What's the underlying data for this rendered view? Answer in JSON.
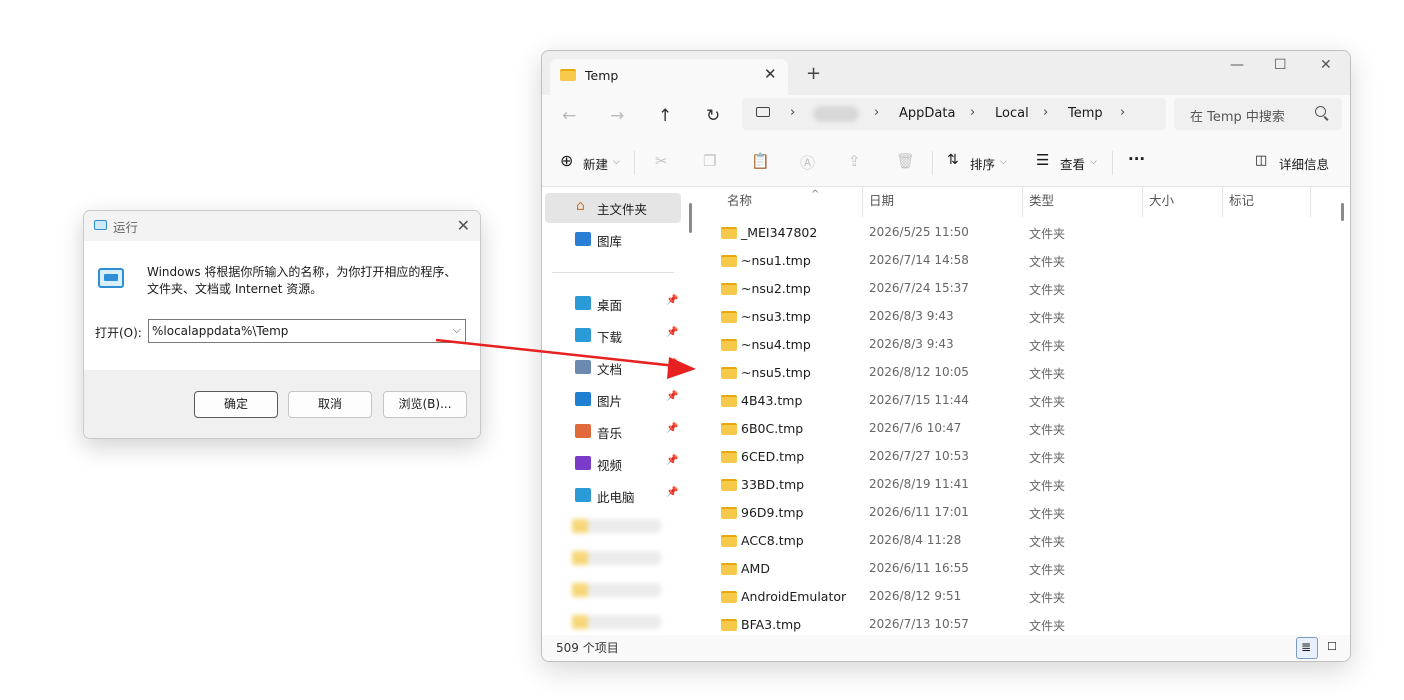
{
  "run": {
    "title": "运行",
    "close": "✕",
    "description": "Windows 将根据你所输入的名称，为你打开相应的程序、文件夹、文档或 Internet 资源。",
    "open_label": "打开(O):",
    "open_value": "%localappdata%\\Temp",
    "ok": "确定",
    "cancel": "取消",
    "browse": "浏览(B)..."
  },
  "explorer": {
    "tab_title": "Temp",
    "tab_close": "✕",
    "new_tab": "+",
    "window_controls": {
      "minimize": "—",
      "maximize": "☐",
      "close": "✕"
    },
    "nav": {
      "back": "←",
      "forward": "→",
      "up": "↑",
      "refresh": "↻"
    },
    "breadcrumb": [
      "AppData",
      "Local",
      "Temp"
    ],
    "breadcrumb_sep": "›",
    "search_placeholder": "在 Temp 中搜索",
    "toolbar": {
      "new": "新建",
      "sort": "排序",
      "view": "查看",
      "more": "···",
      "details": "详细信息"
    },
    "sidebar": {
      "home": "主文件夹",
      "gallery": "图库",
      "pinned": [
        {
          "label": "桌面",
          "color": "#2a9bd6"
        },
        {
          "label": "下载",
          "color": "#2a9bd6"
        },
        {
          "label": "文档",
          "color": "#6c8ab0"
        },
        {
          "label": "图片",
          "color": "#1f7fd0"
        },
        {
          "label": "音乐",
          "color": "#e06a3b"
        },
        {
          "label": "视频",
          "color": "#7a3cc8"
        },
        {
          "label": "此电脑",
          "color": "#2a9bd6"
        }
      ]
    },
    "columns": [
      "名称",
      "日期",
      "类型",
      "大小",
      "标记"
    ],
    "rows": [
      {
        "name": "_MEI347802",
        "date": "2026/5/25 11:50",
        "type": "文件夹"
      },
      {
        "name": "~nsu1.tmp",
        "date": "2026/7/14 14:58",
        "type": "文件夹"
      },
      {
        "name": "~nsu2.tmp",
        "date": "2026/7/24 15:37",
        "type": "文件夹"
      },
      {
        "name": "~nsu3.tmp",
        "date": "2026/8/3 9:43",
        "type": "文件夹"
      },
      {
        "name": "~nsu4.tmp",
        "date": "2026/8/3 9:43",
        "type": "文件夹"
      },
      {
        "name": "~nsu5.tmp",
        "date": "2026/8/12 10:05",
        "type": "文件夹"
      },
      {
        "name": "4B43.tmp",
        "date": "2026/7/15 11:44",
        "type": "文件夹"
      },
      {
        "name": "6B0C.tmp",
        "date": "2026/7/6 10:47",
        "type": "文件夹"
      },
      {
        "name": "6CED.tmp",
        "date": "2026/7/27 10:53",
        "type": "文件夹"
      },
      {
        "name": "33BD.tmp",
        "date": "2026/8/19 11:41",
        "type": "文件夹"
      },
      {
        "name": "96D9.tmp",
        "date": "2026/6/11 17:01",
        "type": "文件夹"
      },
      {
        "name": "ACC8.tmp",
        "date": "2026/8/4 11:28",
        "type": "文件夹"
      },
      {
        "name": "AMD",
        "date": "2026/6/11 16:55",
        "type": "文件夹"
      },
      {
        "name": "AndroidEmulator",
        "date": "2026/8/12 9:51",
        "type": "文件夹"
      },
      {
        "name": "BFA3.tmp",
        "date": "2026/7/13 10:57",
        "type": "文件夹"
      }
    ],
    "status_count": "509 个项目"
  },
  "colors": {
    "accent": "#2e8fd6",
    "folder": "#f7c94a",
    "arrow": "#e8201f"
  }
}
